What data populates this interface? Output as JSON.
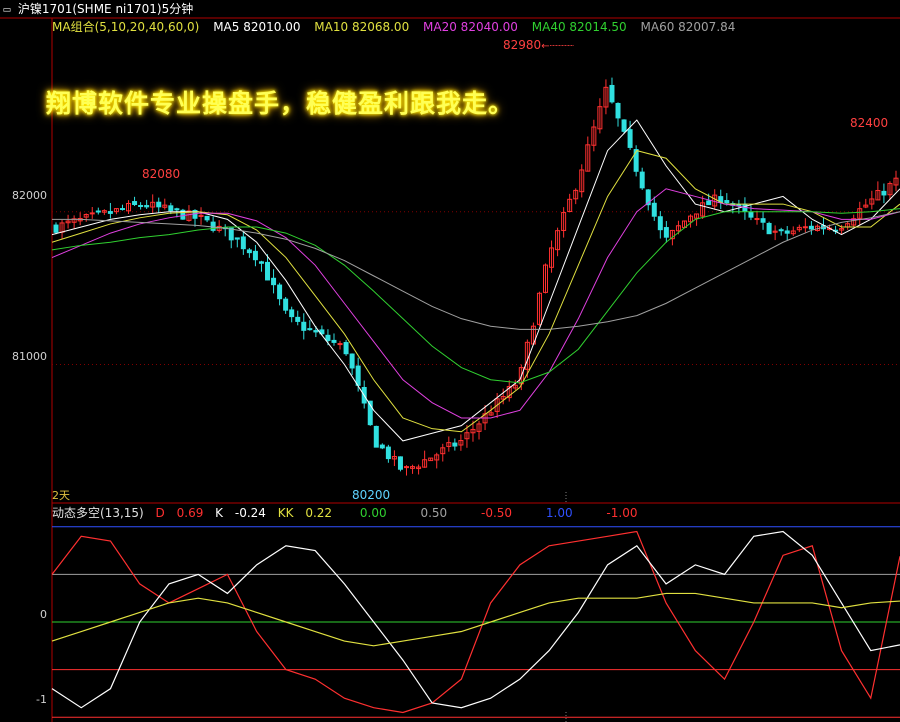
{
  "window": {
    "title": "沪镍1701(SHME ni1701)5分钟",
    "icon": "window-menu-icon"
  },
  "ma_legend": {
    "group": "MA组合(5,10,20,40,60,0)",
    "ma5": "MA5 82010.00",
    "ma10": "MA10 82068.00",
    "ma20": "MA20 82040.00",
    "ma40": "MA40 82014.50",
    "ma60": "MA60 82007.84"
  },
  "colors": {
    "ma5": "#ffffff",
    "ma10": "#e0e040",
    "ma20": "#e040e0",
    "ma40": "#30d030",
    "ma60": "#a0a0a0",
    "up": "#ff3030",
    "down": "#30e0e0"
  },
  "price_axis": {
    "labels": [
      "82000",
      "81000"
    ]
  },
  "annotations": {
    "high": "82980",
    "left_high": "82080",
    "right_high": "82400",
    "low": "80200"
  },
  "banner": "翔博软件专业操盘手，稳健盈利跟我走。",
  "range_label": "2天",
  "indicator": {
    "name": "动态多空(13,15)",
    "d_label": "D",
    "d_value": "0.69",
    "k_label": "K",
    "k_value": "-0.24",
    "kk_label": "KK",
    "kk_value": "0.22",
    "levels": [
      "0.00",
      "0.50",
      "-0.50",
      "1.00",
      "-1.00"
    ],
    "axis_labels": [
      "0",
      "-1"
    ]
  },
  "chart_data": {
    "type": "line",
    "title": "沪镍1701(SHME ni1701)5分钟",
    "ylim": [
      80100,
      83150
    ],
    "x": [
      0,
      10,
      20,
      30,
      40,
      50,
      60,
      70,
      80,
      90,
      100,
      110,
      120,
      130,
      140,
      150,
      160,
      170,
      180,
      190,
      200,
      210,
      220,
      230,
      240,
      250,
      260,
      270,
      280,
      290
    ],
    "series": [
      {
        "name": "MA5",
        "values": [
          81850,
          81900,
          81950,
          81980,
          82000,
          82000,
          81950,
          81800,
          81550,
          81250,
          81000,
          80700,
          80500,
          80550,
          80600,
          80750,
          80900,
          81400,
          81900,
          82400,
          82600,
          82300,
          82050,
          82000,
          82050,
          82100,
          81950,
          81850,
          81950,
          82150
        ]
      },
      {
        "name": "MA10",
        "values": [
          81800,
          81860,
          81920,
          81960,
          81990,
          82000,
          81980,
          81880,
          81700,
          81450,
          81200,
          80900,
          80650,
          80580,
          80560,
          80700,
          80850,
          81200,
          81650,
          82100,
          82400,
          82350,
          82150,
          82050,
          82050,
          82050,
          82000,
          81900,
          81900,
          82050
        ]
      },
      {
        "name": "MA20",
        "values": [
          81700,
          81780,
          81860,
          81920,
          81960,
          81990,
          81990,
          81940,
          81830,
          81650,
          81400,
          81150,
          80900,
          80750,
          80650,
          80650,
          80700,
          80950,
          81300,
          81700,
          82000,
          82150,
          82100,
          82050,
          82020,
          82010,
          82000,
          81950,
          81950,
          82000
        ]
      },
      {
        "name": "MA40",
        "values": [
          81750,
          81780,
          81800,
          81830,
          81850,
          81880,
          81900,
          81900,
          81860,
          81780,
          81650,
          81480,
          81300,
          81120,
          80980,
          80900,
          80880,
          80950,
          81100,
          81350,
          81600,
          81800,
          81950,
          82000,
          82000,
          82000,
          82000,
          81990,
          82000,
          82020
        ]
      },
      {
        "name": "MA60",
        "values": [
          81950,
          81950,
          81940,
          81930,
          81920,
          81910,
          81890,
          81860,
          81820,
          81760,
          81680,
          81580,
          81480,
          81380,
          81300,
          81250,
          81230,
          81230,
          81250,
          81280,
          81320,
          81400,
          81500,
          81600,
          81700,
          81800,
          81880,
          81930,
          81960,
          82000
        ]
      },
      {
        "name": "Close",
        "values": [
          81900,
          81950,
          82000,
          82050,
          82000,
          81950,
          81850,
          81700,
          81300,
          81200,
          81100,
          80500,
          80300,
          80400,
          80500,
          80700,
          80900,
          81700,
          82200,
          82800,
          82300,
          81800,
          82000,
          82100,
          81950,
          81850,
          81900,
          81900,
          82050,
          82200
        ]
      }
    ],
    "annotations": [
      {
        "label": "82980",
        "x": 192,
        "y": 82980
      },
      {
        "label": "82080",
        "x": 40,
        "y": 82080
      },
      {
        "label": "82400",
        "x": 284,
        "y": 82400
      },
      {
        "label": "80200",
        "x": 116,
        "y": 80200
      }
    ],
    "subchart": {
      "title": "动态多空(13,15)",
      "ylim": [
        -1.05,
        1.05
      ],
      "levels": [
        0,
        0.5,
        -0.5,
        1,
        -1
      ],
      "x": [
        0,
        10,
        20,
        30,
        40,
        50,
        60,
        70,
        80,
        90,
        100,
        110,
        120,
        130,
        140,
        150,
        160,
        170,
        180,
        190,
        200,
        210,
        220,
        230,
        240,
        250,
        260,
        270,
        280,
        290
      ],
      "series": [
        {
          "name": "D",
          "values": [
            0.5,
            0.9,
            0.85,
            0.4,
            0.2,
            0.35,
            0.5,
            -0.1,
            -0.5,
            -0.6,
            -0.8,
            -0.9,
            -0.95,
            -0.85,
            -0.6,
            0.2,
            0.6,
            0.8,
            0.85,
            0.9,
            0.95,
            0.2,
            -0.3,
            -0.6,
            0.0,
            0.7,
            0.8,
            -0.3,
            -0.8,
            0.69
          ]
        },
        {
          "name": "K",
          "values": [
            -0.7,
            -0.9,
            -0.7,
            0.0,
            0.4,
            0.5,
            0.3,
            0.6,
            0.8,
            0.75,
            0.4,
            0.0,
            -0.4,
            -0.85,
            -0.9,
            -0.8,
            -0.6,
            -0.3,
            0.1,
            0.6,
            0.8,
            0.4,
            0.6,
            0.5,
            0.9,
            0.95,
            0.7,
            0.2,
            -0.3,
            -0.24
          ]
        },
        {
          "name": "KK",
          "values": [
            -0.2,
            -0.1,
            0.0,
            0.1,
            0.2,
            0.25,
            0.2,
            0.1,
            0.0,
            -0.1,
            -0.2,
            -0.25,
            -0.2,
            -0.15,
            -0.1,
            0.0,
            0.1,
            0.2,
            0.25,
            0.25,
            0.25,
            0.3,
            0.3,
            0.25,
            0.2,
            0.2,
            0.2,
            0.15,
            0.2,
            0.22
          ]
        }
      ]
    }
  }
}
